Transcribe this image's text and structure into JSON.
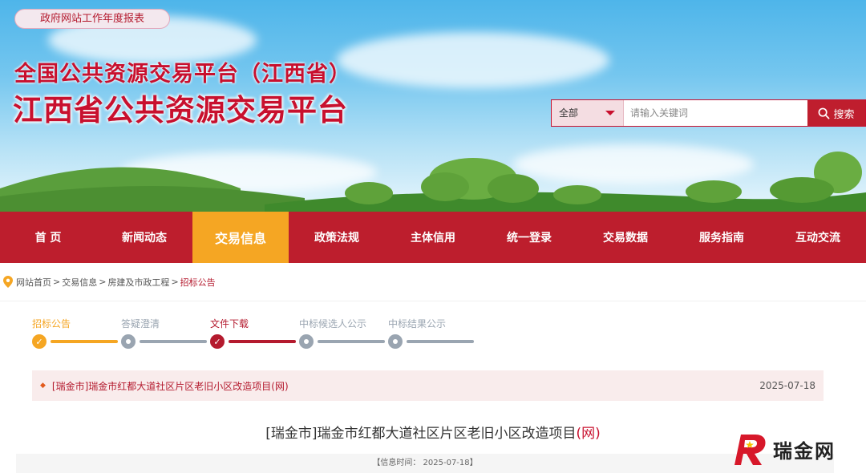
{
  "header": {
    "report_link": "政府网站工作年度报表",
    "subtitle": "全国公共资源交易平台（江西省）",
    "title": "江西省公共资源交易平台"
  },
  "search": {
    "scope": "全部",
    "placeholder": "请输入关键词",
    "button": "搜索"
  },
  "nav": {
    "items": [
      {
        "label": "首 页"
      },
      {
        "label": "新闻动态"
      },
      {
        "label": "交易信息"
      },
      {
        "label": "政策法规"
      },
      {
        "label": "主体信用"
      },
      {
        "label": "统一登录"
      },
      {
        "label": "交易数据"
      },
      {
        "label": "服务指南"
      },
      {
        "label": "互动交流"
      }
    ],
    "active_index": 2
  },
  "breadcrumb": {
    "items": [
      "网站首页",
      "交易信息",
      "房建及市政工程",
      "招标公告"
    ],
    "separator": ">"
  },
  "steps": {
    "items": [
      {
        "label": "招标公告",
        "state": "done",
        "color": "#f5a623"
      },
      {
        "label": "答疑澄清",
        "state": "pending",
        "color": "#9aa5b1"
      },
      {
        "label": "文件下载",
        "state": "current",
        "color": "#b41a2e"
      },
      {
        "label": "中标候选人公示",
        "state": "pending",
        "color": "#9aa5b1"
      },
      {
        "label": "中标结果公示",
        "state": "pending",
        "color": "#9aa5b1"
      }
    ]
  },
  "list_item": {
    "title": "[瑞金市]瑞金市红都大道社区片区老旧小区改造项目(网)",
    "date": "2025-07-18"
  },
  "article": {
    "title_main": "[瑞金市]瑞金市红都大道社区片区老旧小区改造项目",
    "title_tag": "(网)",
    "meta": "【信息时间：  2025-07-18】"
  },
  "watermark": {
    "text": "瑞金网"
  },
  "colors": {
    "brand_red": "#bd1e2d",
    "active_orange": "#f5a623",
    "pending_gray": "#9aa5b1"
  }
}
